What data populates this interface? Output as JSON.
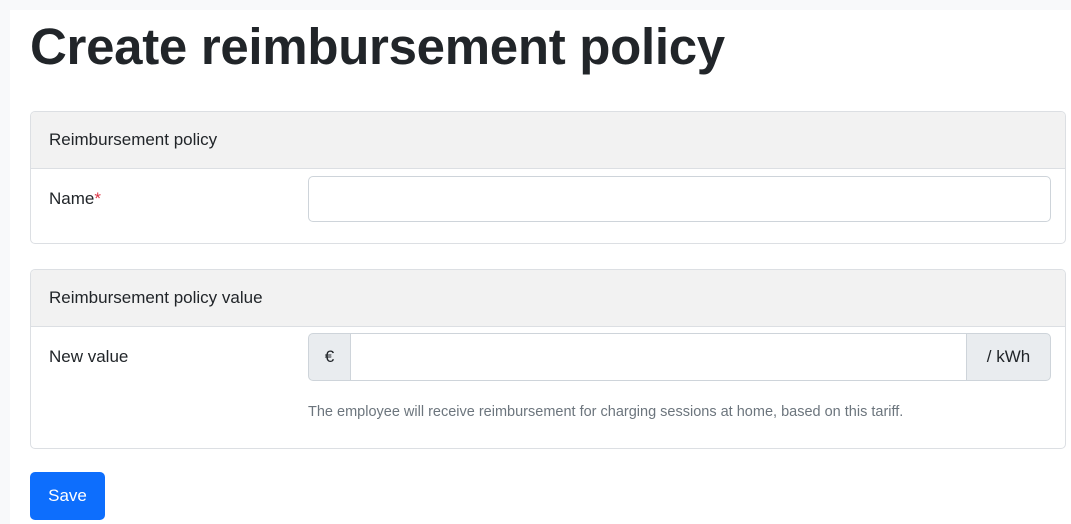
{
  "page": {
    "title": "Create reimbursement policy"
  },
  "policy_card": {
    "header": "Reimbursement policy",
    "name_label": "Name",
    "required_mark": "*",
    "name_value": "",
    "name_placeholder": ""
  },
  "value_card": {
    "header": "Reimbursement policy value",
    "new_value_label": "New value",
    "currency_prefix": "€",
    "unit_suffix": "/ kWh",
    "value": "",
    "placeholder": "",
    "help_text": "The employee will receive reimbursement for charging sessions at home, based on this tariff."
  },
  "actions": {
    "save_label": "Save"
  },
  "colors": {
    "primary": "#0d6efd",
    "required": "#dc3545",
    "card_header_bg": "#f2f2f2",
    "addon_bg": "#e9ecef",
    "muted_text": "#6c757d"
  }
}
